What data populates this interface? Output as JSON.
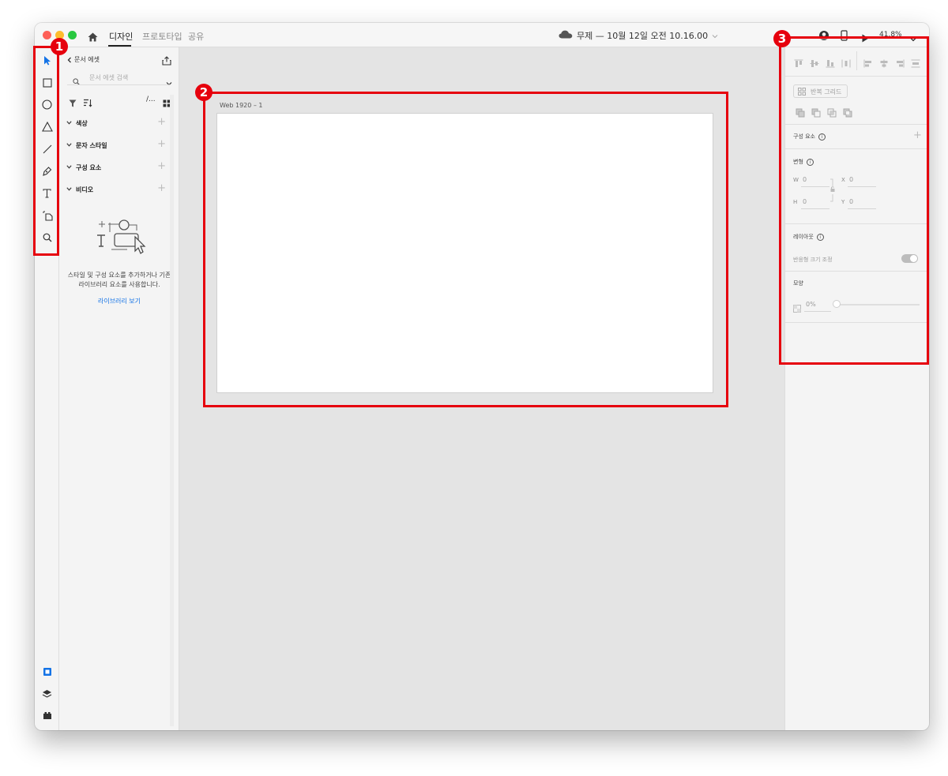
{
  "titlebar": {
    "tabs": [
      {
        "label": "디자인",
        "active": true
      },
      {
        "label": "프로토타입",
        "active": false
      },
      {
        "label": "공유",
        "active": false
      }
    ],
    "doc_title": "무제 — 10월 12일 오전 10.16.00",
    "zoom": "41.8%"
  },
  "toolbar": {
    "tools": [
      "select-icon",
      "rectangle-icon",
      "ellipse-icon",
      "triangle-icon",
      "line-icon",
      "pen-icon",
      "text-icon",
      "artboard-icon",
      "zoom-icon"
    ],
    "bottom": [
      "document-assets-icon",
      "layers-icon",
      "plugins-icon"
    ]
  },
  "assets": {
    "header": "문서 에셋",
    "search_placeholder": "문서 에셋 검색",
    "sections": [
      "색상",
      "문자 스타일",
      "구성 요소",
      "비디오"
    ],
    "empty_message": "스타일 및 구성 요소를 추가하거나 기존 라이브러리 요소를 사용합니다.",
    "libraries_link": "라이브러리 보기"
  },
  "canvas": {
    "artboard_label": "Web 1920 – 1"
  },
  "properties": {
    "repeat_grid": "반복 그리드",
    "components": "구성 요소",
    "transform": "변형",
    "w_label": "W",
    "w_value": "0",
    "h_label": "H",
    "h_value": "0",
    "x_label": "X",
    "x_value": "0",
    "y_label": "Y",
    "y_value": "0",
    "layout": "레이아웃",
    "responsive_resize": "반응형 크기 조정",
    "appearance": "모양",
    "opacity": "0%"
  },
  "annotations": [
    "1",
    "2",
    "3"
  ],
  "colors": {
    "accent": "#1473e6",
    "annotation": "#e6000d",
    "traffic_red": "#fe5f57",
    "traffic_yellow": "#febc2e",
    "traffic_green": "#28c840"
  }
}
